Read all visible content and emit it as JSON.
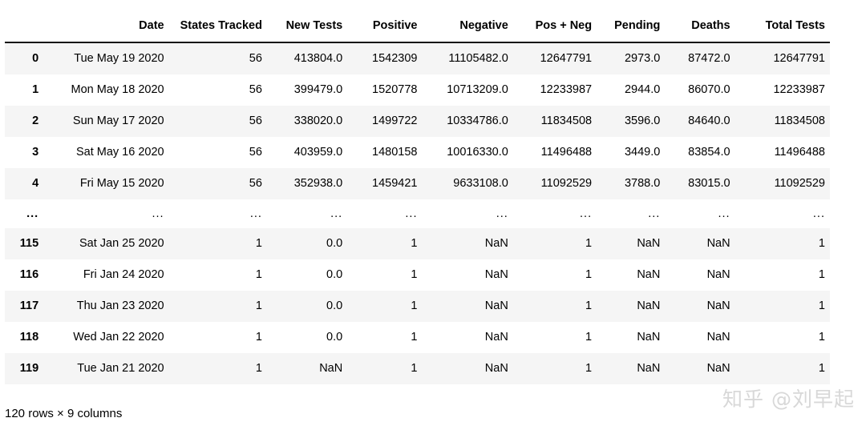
{
  "table": {
    "index_header": "",
    "columns": [
      "Date",
      "States Tracked",
      "New Tests",
      "Positive",
      "Negative",
      "Pos + Neg",
      "Pending",
      "Deaths",
      "Total Tests"
    ],
    "rows": [
      {
        "index": "0",
        "cells": [
          "Tue May 19 2020",
          "56",
          "413804.0",
          "1542309",
          "11105482.0",
          "12647791",
          "2973.0",
          "87472.0",
          "12647791"
        ]
      },
      {
        "index": "1",
        "cells": [
          "Mon May 18 2020",
          "56",
          "399479.0",
          "1520778",
          "10713209.0",
          "12233987",
          "2944.0",
          "86070.0",
          "12233987"
        ]
      },
      {
        "index": "2",
        "cells": [
          "Sun May 17 2020",
          "56",
          "338020.0",
          "1499722",
          "10334786.0",
          "11834508",
          "3596.0",
          "84640.0",
          "11834508"
        ]
      },
      {
        "index": "3",
        "cells": [
          "Sat May 16 2020",
          "56",
          "403959.0",
          "1480158",
          "10016330.0",
          "11496488",
          "3449.0",
          "83854.0",
          "11496488"
        ]
      },
      {
        "index": "4",
        "cells": [
          "Fri May 15 2020",
          "56",
          "352938.0",
          "1459421",
          "9633108.0",
          "11092529",
          "3788.0",
          "83015.0",
          "11092529"
        ]
      },
      {
        "index": "...",
        "cells": [
          "...",
          "...",
          "...",
          "...",
          "...",
          "...",
          "...",
          "...",
          "..."
        ]
      },
      {
        "index": "115",
        "cells": [
          "Sat Jan 25 2020",
          "1",
          "0.0",
          "1",
          "NaN",
          "1",
          "NaN",
          "NaN",
          "1"
        ]
      },
      {
        "index": "116",
        "cells": [
          "Fri Jan 24 2020",
          "1",
          "0.0",
          "1",
          "NaN",
          "1",
          "NaN",
          "NaN",
          "1"
        ]
      },
      {
        "index": "117",
        "cells": [
          "Thu Jan 23 2020",
          "1",
          "0.0",
          "1",
          "NaN",
          "1",
          "NaN",
          "NaN",
          "1"
        ]
      },
      {
        "index": "118",
        "cells": [
          "Wed Jan 22 2020",
          "1",
          "0.0",
          "1",
          "NaN",
          "1",
          "NaN",
          "NaN",
          "1"
        ]
      },
      {
        "index": "119",
        "cells": [
          "Tue Jan 21 2020",
          "1",
          "NaN",
          "1",
          "NaN",
          "1",
          "NaN",
          "NaN",
          "1"
        ]
      }
    ]
  },
  "footer": {
    "shape_text": "120 rows × 9 columns"
  },
  "watermark": {
    "text": "知乎 @刘早起"
  },
  "colors": {
    "stripe": "#f5f5f5",
    "text": "#000000",
    "header_rule": "#111111",
    "watermark": "#d8d8d8"
  }
}
